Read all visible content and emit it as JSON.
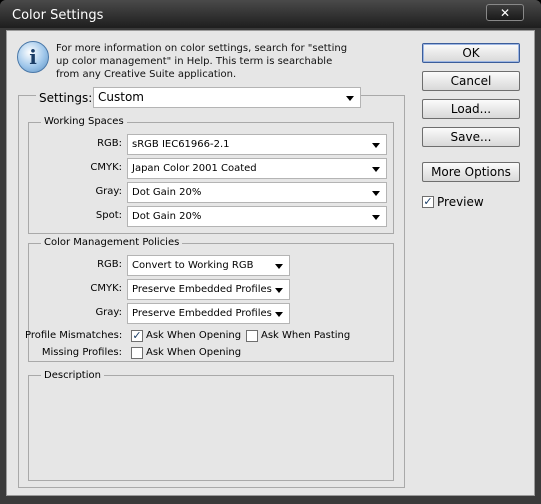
{
  "window": {
    "title": "Color Settings",
    "close_glyph": "✕"
  },
  "info": {
    "icon_name": "info-icon",
    "icon_glyph": "i",
    "text": "For more information on color settings, search for \"setting up color management\" in Help. This term is searchable from any Creative Suite application."
  },
  "settings": {
    "label": "Settings:",
    "value": "Custom"
  },
  "working_spaces": {
    "title": "Working Spaces",
    "rows": [
      {
        "label": "RGB:",
        "value": "sRGB IEC61966-2.1"
      },
      {
        "label": "CMYK:",
        "value": "Japan Color 2001 Coated"
      },
      {
        "label": "Gray:",
        "value": "Dot Gain 20%"
      },
      {
        "label": "Spot:",
        "value": "Dot Gain 20%"
      }
    ]
  },
  "policies": {
    "title": "Color Management Policies",
    "rows": [
      {
        "label": "RGB:",
        "value": "Convert to Working RGB"
      },
      {
        "label": "CMYK:",
        "value": "Preserve Embedded Profiles"
      },
      {
        "label": "Gray:",
        "value": "Preserve Embedded Profiles"
      }
    ],
    "profile_mismatches": {
      "label": "Profile Mismatches:",
      "ask_opening": {
        "label": "Ask When Opening",
        "checked": true
      },
      "ask_pasting": {
        "label": "Ask When Pasting",
        "checked": false
      }
    },
    "missing_profiles": {
      "label": "Missing Profiles:",
      "ask_opening": {
        "label": "Ask When Opening",
        "checked": false
      }
    }
  },
  "description": {
    "title": "Description"
  },
  "buttons": {
    "ok": "OK",
    "cancel": "Cancel",
    "load": "Load...",
    "save": "Save...",
    "more_options": "More Options"
  },
  "preview": {
    "label": "Preview",
    "checked": true
  },
  "check_glyph": "✓"
}
